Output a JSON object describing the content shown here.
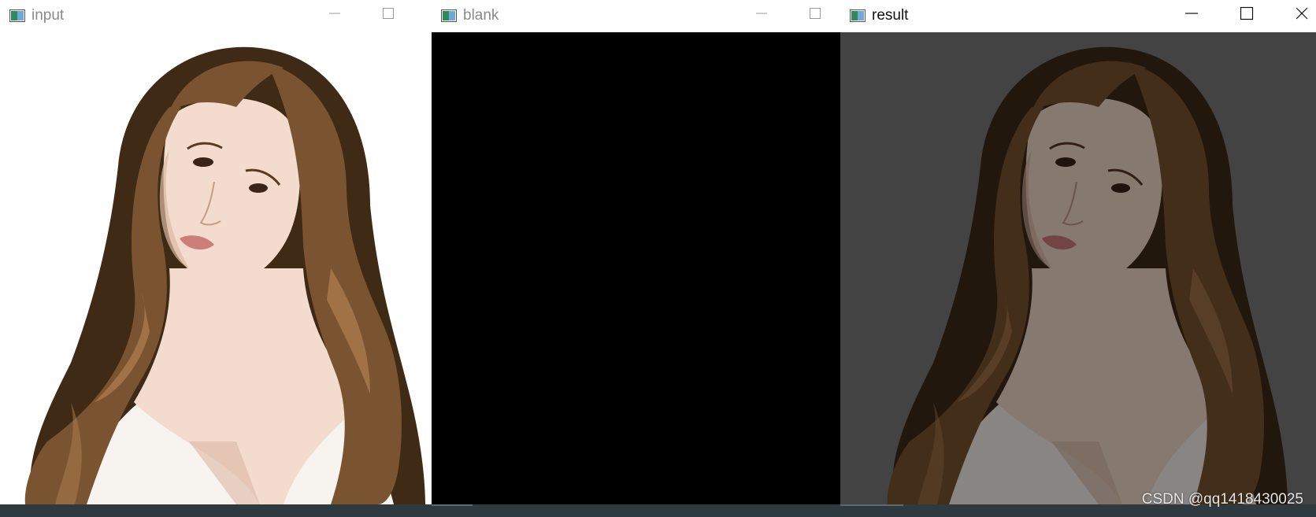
{
  "windows": [
    {
      "title": "input",
      "active": false,
      "content": "portrait",
      "background": "#ffffff",
      "dim": 0.0
    },
    {
      "title": "blank",
      "active": false,
      "content": "black",
      "background": "#000000"
    },
    {
      "title": "result",
      "active": true,
      "content": "portrait",
      "background": "#7b7b7b",
      "dim": 0.45
    }
  ],
  "icons": {
    "app": "image-window-icon",
    "minimize": "minimize-icon",
    "maximize": "maximize-icon",
    "close": "close-icon"
  },
  "colors": {
    "hair": "#7a5430",
    "hair_dark": "#3f2a16",
    "hair_light": "#b07f4f",
    "skin": "#f3dccd",
    "skin_shadow": "#dcb8a3",
    "dress": "#f7f3ef",
    "lips": "#cc7f7a",
    "taskbar": "#2f3a40"
  },
  "watermark": "CSDN @qq1418430025"
}
